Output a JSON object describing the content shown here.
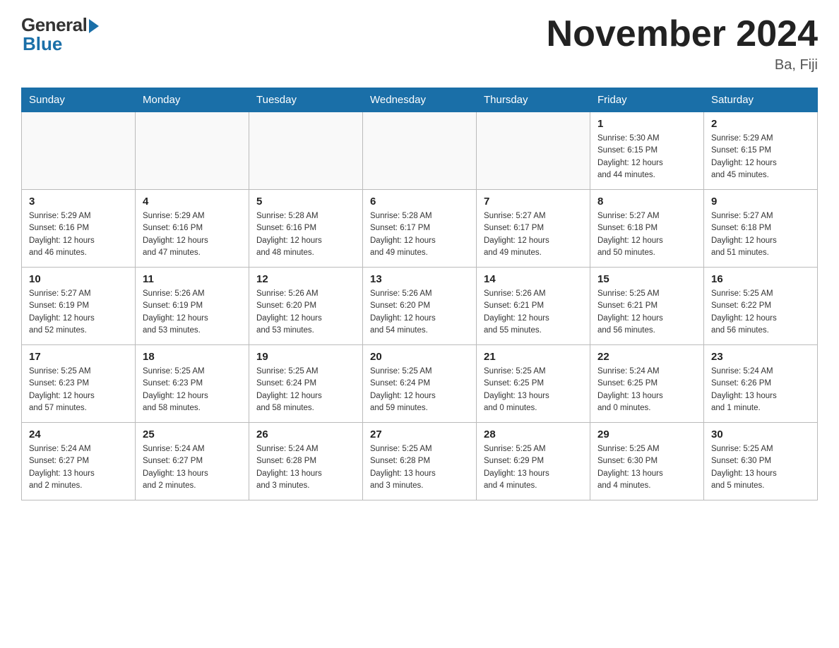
{
  "header": {
    "logo_general": "General",
    "logo_blue": "Blue",
    "month_title": "November 2024",
    "location": "Ba, Fiji"
  },
  "weekdays": [
    "Sunday",
    "Monday",
    "Tuesday",
    "Wednesday",
    "Thursday",
    "Friday",
    "Saturday"
  ],
  "weeks": [
    [
      {
        "day": "",
        "info": ""
      },
      {
        "day": "",
        "info": ""
      },
      {
        "day": "",
        "info": ""
      },
      {
        "day": "",
        "info": ""
      },
      {
        "day": "",
        "info": ""
      },
      {
        "day": "1",
        "info": "Sunrise: 5:30 AM\nSunset: 6:15 PM\nDaylight: 12 hours\nand 44 minutes."
      },
      {
        "day": "2",
        "info": "Sunrise: 5:29 AM\nSunset: 6:15 PM\nDaylight: 12 hours\nand 45 minutes."
      }
    ],
    [
      {
        "day": "3",
        "info": "Sunrise: 5:29 AM\nSunset: 6:16 PM\nDaylight: 12 hours\nand 46 minutes."
      },
      {
        "day": "4",
        "info": "Sunrise: 5:29 AM\nSunset: 6:16 PM\nDaylight: 12 hours\nand 47 minutes."
      },
      {
        "day": "5",
        "info": "Sunrise: 5:28 AM\nSunset: 6:16 PM\nDaylight: 12 hours\nand 48 minutes."
      },
      {
        "day": "6",
        "info": "Sunrise: 5:28 AM\nSunset: 6:17 PM\nDaylight: 12 hours\nand 49 minutes."
      },
      {
        "day": "7",
        "info": "Sunrise: 5:27 AM\nSunset: 6:17 PM\nDaylight: 12 hours\nand 49 minutes."
      },
      {
        "day": "8",
        "info": "Sunrise: 5:27 AM\nSunset: 6:18 PM\nDaylight: 12 hours\nand 50 minutes."
      },
      {
        "day": "9",
        "info": "Sunrise: 5:27 AM\nSunset: 6:18 PM\nDaylight: 12 hours\nand 51 minutes."
      }
    ],
    [
      {
        "day": "10",
        "info": "Sunrise: 5:27 AM\nSunset: 6:19 PM\nDaylight: 12 hours\nand 52 minutes."
      },
      {
        "day": "11",
        "info": "Sunrise: 5:26 AM\nSunset: 6:19 PM\nDaylight: 12 hours\nand 53 minutes."
      },
      {
        "day": "12",
        "info": "Sunrise: 5:26 AM\nSunset: 6:20 PM\nDaylight: 12 hours\nand 53 minutes."
      },
      {
        "day": "13",
        "info": "Sunrise: 5:26 AM\nSunset: 6:20 PM\nDaylight: 12 hours\nand 54 minutes."
      },
      {
        "day": "14",
        "info": "Sunrise: 5:26 AM\nSunset: 6:21 PM\nDaylight: 12 hours\nand 55 minutes."
      },
      {
        "day": "15",
        "info": "Sunrise: 5:25 AM\nSunset: 6:21 PM\nDaylight: 12 hours\nand 56 minutes."
      },
      {
        "day": "16",
        "info": "Sunrise: 5:25 AM\nSunset: 6:22 PM\nDaylight: 12 hours\nand 56 minutes."
      }
    ],
    [
      {
        "day": "17",
        "info": "Sunrise: 5:25 AM\nSunset: 6:23 PM\nDaylight: 12 hours\nand 57 minutes."
      },
      {
        "day": "18",
        "info": "Sunrise: 5:25 AM\nSunset: 6:23 PM\nDaylight: 12 hours\nand 58 minutes."
      },
      {
        "day": "19",
        "info": "Sunrise: 5:25 AM\nSunset: 6:24 PM\nDaylight: 12 hours\nand 58 minutes."
      },
      {
        "day": "20",
        "info": "Sunrise: 5:25 AM\nSunset: 6:24 PM\nDaylight: 12 hours\nand 59 minutes."
      },
      {
        "day": "21",
        "info": "Sunrise: 5:25 AM\nSunset: 6:25 PM\nDaylight: 13 hours\nand 0 minutes."
      },
      {
        "day": "22",
        "info": "Sunrise: 5:24 AM\nSunset: 6:25 PM\nDaylight: 13 hours\nand 0 minutes."
      },
      {
        "day": "23",
        "info": "Sunrise: 5:24 AM\nSunset: 6:26 PM\nDaylight: 13 hours\nand 1 minute."
      }
    ],
    [
      {
        "day": "24",
        "info": "Sunrise: 5:24 AM\nSunset: 6:27 PM\nDaylight: 13 hours\nand 2 minutes."
      },
      {
        "day": "25",
        "info": "Sunrise: 5:24 AM\nSunset: 6:27 PM\nDaylight: 13 hours\nand 2 minutes."
      },
      {
        "day": "26",
        "info": "Sunrise: 5:24 AM\nSunset: 6:28 PM\nDaylight: 13 hours\nand 3 minutes."
      },
      {
        "day": "27",
        "info": "Sunrise: 5:25 AM\nSunset: 6:28 PM\nDaylight: 13 hours\nand 3 minutes."
      },
      {
        "day": "28",
        "info": "Sunrise: 5:25 AM\nSunset: 6:29 PM\nDaylight: 13 hours\nand 4 minutes."
      },
      {
        "day": "29",
        "info": "Sunrise: 5:25 AM\nSunset: 6:30 PM\nDaylight: 13 hours\nand 4 minutes."
      },
      {
        "day": "30",
        "info": "Sunrise: 5:25 AM\nSunset: 6:30 PM\nDaylight: 13 hours\nand 5 minutes."
      }
    ]
  ]
}
